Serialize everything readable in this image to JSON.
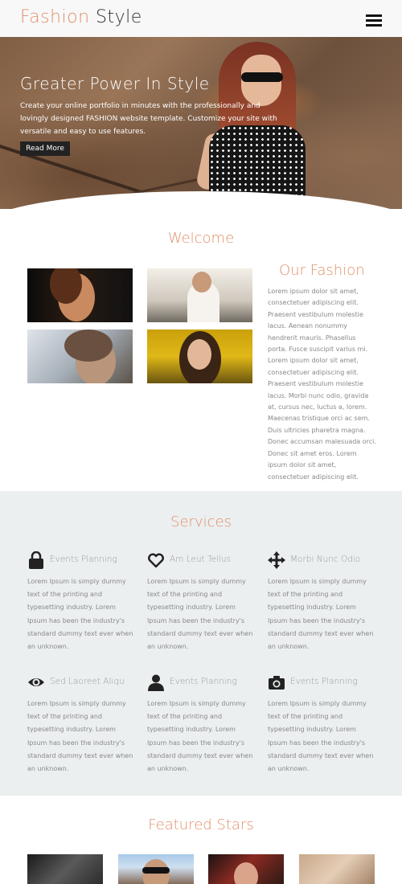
{
  "header": {
    "logo_part1": "Fashion",
    "logo_part2": "Style",
    "menu_icon": "hamburger-menu-icon"
  },
  "hero": {
    "title": "Greater Power In Style",
    "text": "Create your online portfolio in minutes with the professionally and lovingly designed FASHION website template. Customize your site with versatile and easy to use features.",
    "button_label": "Read More"
  },
  "welcome": {
    "title": "Welcome",
    "our_title": "Our Fashion",
    "our_text": "Lorem ipsum dolor sit amet, consectetuer adipiscing elit. Praesent vestibulum molestie lacus. Aenean nonummy hendrerit mauris. Phasellus porta. Fusce suscipit varius mi. Lorem ipsum dolor sit amet, consectetuer adipiscing elit. Praesent vestibulum molestie lacus. Morbi nunc odio, gravida at, cursus nec, luctus a, lorem. Maecenas tristique orci ac sem. Duis ultricies pharetra magna. Donec accumsan malesuada orci. Donec sit amet eros. Lorem ipsum dolor sit amet, consectetuer adipiscing elit."
  },
  "services": {
    "title": "Services",
    "items": [
      {
        "title": "Events Planning",
        "icon": "lock-icon",
        "text": "Lorem Ipsum is simply dummy text of the printing and typesetting industry. Lorem Ipsum has been the industry's standard dummy text ever when an unknown."
      },
      {
        "title": "Am Leut Tellus",
        "icon": "heart-icon",
        "text": "Lorem Ipsum is simply dummy text of the printing and typesetting industry. Lorem Ipsum has been the industry's standard dummy text ever when an unknown."
      },
      {
        "title": "Morbi Nunc Odio",
        "icon": "move-arrows-icon",
        "text": "Lorem Ipsum is simply dummy text of the printing and typesetting industry. Lorem Ipsum has been the industry's standard dummy text ever when an unknown."
      },
      {
        "title": "Sed Laoreet Aliqu",
        "icon": "eye-icon",
        "text": "Lorem Ipsum is simply dummy text of the printing and typesetting industry. Lorem Ipsum has been the industry's standard dummy text ever when an unknown."
      },
      {
        "title": "Events Planning",
        "icon": "user-icon",
        "text": "Lorem Ipsum is simply dummy text of the printing and typesetting industry. Lorem Ipsum has been the industry's standard dummy text ever when an unknown."
      },
      {
        "title": "Events Planning",
        "icon": "camera-icon",
        "text": "Lorem Ipsum is simply dummy text of the printing and typesetting industry. Lorem Ipsum has been the industry's standard dummy text ever when an unknown."
      }
    ]
  },
  "featured": {
    "title": "Featured Stars"
  },
  "colors": {
    "accent": "#e0906a",
    "services_bg": "#eceff0",
    "header_bg": "#f8f8f8"
  }
}
